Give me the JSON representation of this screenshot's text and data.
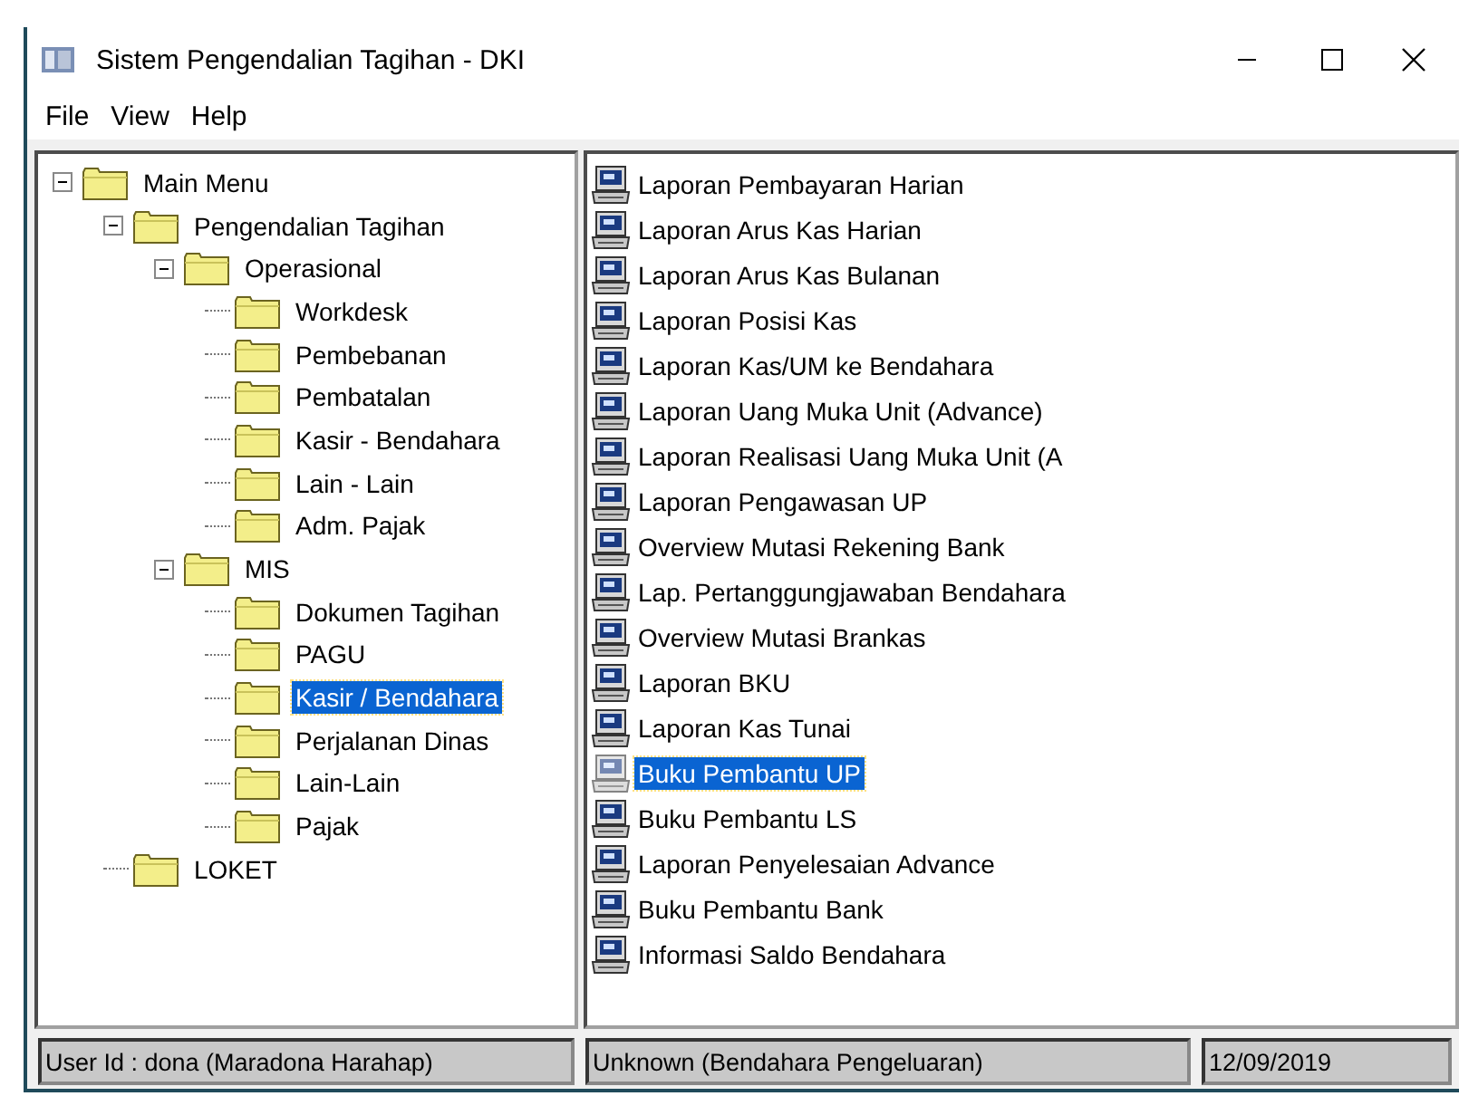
{
  "window": {
    "title": "Sistem Pengendalian Tagihan - DKI"
  },
  "menu": [
    "File",
    "View",
    "Help"
  ],
  "tree": [
    {
      "label": "Main Menu",
      "expanded": true,
      "selected": false,
      "children": [
        {
          "label": "Pengendalian Tagihan",
          "expanded": true,
          "selected": false,
          "children": [
            {
              "label": "Operasional",
              "expanded": true,
              "selected": false,
              "children": [
                {
                  "label": "Workdesk",
                  "selected": false
                },
                {
                  "label": "Pembebanan",
                  "selected": false
                },
                {
                  "label": "Pembatalan",
                  "selected": false
                },
                {
                  "label": "Kasir - Bendahara",
                  "selected": false
                },
                {
                  "label": "Lain - Lain",
                  "selected": false
                },
                {
                  "label": "Adm. Pajak",
                  "selected": false
                }
              ]
            },
            {
              "label": "MIS",
              "expanded": true,
              "selected": false,
              "children": [
                {
                  "label": "Dokumen Tagihan",
                  "selected": false
                },
                {
                  "label": "PAGU",
                  "selected": false
                },
                {
                  "label": "Kasir / Bendahara",
                  "selected": true
                },
                {
                  "label": "Perjalanan Dinas",
                  "selected": false
                },
                {
                  "label": "Lain-Lain",
                  "selected": false
                },
                {
                  "label": "Pajak",
                  "selected": false
                }
              ]
            }
          ]
        },
        {
          "label": "LOKET",
          "selected": false
        }
      ]
    }
  ],
  "reports": [
    {
      "label": "Laporan Pembayaran Harian",
      "selected": false
    },
    {
      "label": "Laporan Arus Kas Harian",
      "selected": false
    },
    {
      "label": "Laporan Arus Kas Bulanan",
      "selected": false
    },
    {
      "label": "Laporan Posisi Kas",
      "selected": false
    },
    {
      "label": "Laporan Kas/UM ke Bendahara",
      "selected": false
    },
    {
      "label": "Laporan Uang Muka Unit (Advance)",
      "selected": false
    },
    {
      "label": "Laporan Realisasi Uang Muka Unit (A",
      "selected": false
    },
    {
      "label": "Laporan Pengawasan UP",
      "selected": false
    },
    {
      "label": "Overview Mutasi Rekening Bank",
      "selected": false
    },
    {
      "label": "Lap. Pertanggungjawaban Bendahara",
      "selected": false
    },
    {
      "label": "Overview Mutasi Brankas",
      "selected": false
    },
    {
      "label": "Laporan BKU",
      "selected": false
    },
    {
      "label": "Laporan Kas Tunai",
      "selected": false
    },
    {
      "label": "Buku Pembantu UP",
      "selected": true
    },
    {
      "label": "Buku Pembantu LS",
      "selected": false
    },
    {
      "label": "Laporan Penyelesaian Advance",
      "selected": false
    },
    {
      "label": "Buku Pembantu Bank",
      "selected": false
    },
    {
      "label": "Informasi Saldo Bendahara",
      "selected": false
    }
  ],
  "status_bar": [
    "User Id : dona (Maradona Harahap)",
    "Unknown  (Bendahara Pengeluaran)",
    "12/09/2019"
  ]
}
